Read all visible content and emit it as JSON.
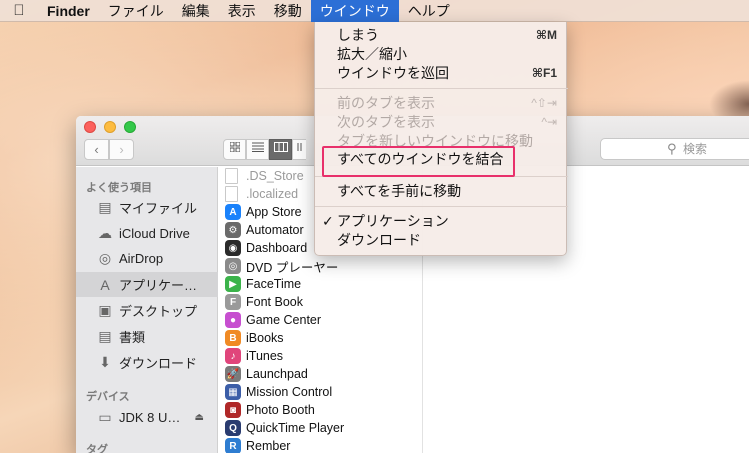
{
  "menubar": {
    "apple_icon": "apple-icon",
    "items": [
      "Finder",
      "ファイル",
      "編集",
      "表示",
      "移動",
      "ウインドウ",
      "ヘルプ"
    ]
  },
  "window_menu": {
    "items": [
      {
        "label": "しまう",
        "shortcut": "⌘M",
        "disabled": false
      },
      {
        "label": "拡大／縮小",
        "shortcut": "",
        "disabled": false
      },
      {
        "label": "ウインドウを巡回",
        "shortcut": "⌘F1",
        "disabled": false
      },
      {
        "label": "前のタブを表示",
        "shortcut": "^⇧⇥",
        "disabled": true
      },
      {
        "label": "次のタブを表示",
        "shortcut": "^⇥",
        "disabled": true
      },
      {
        "label": "タブを新しいウインドウに移動",
        "shortcut": "",
        "disabled": true
      },
      {
        "label": "すべてのウインドウを結合",
        "shortcut": "",
        "disabled": false
      },
      {
        "label": "すべてを手前に移動",
        "shortcut": "",
        "disabled": false
      },
      {
        "label": "アプリケーション",
        "shortcut": "",
        "disabled": false,
        "checked": true
      },
      {
        "label": "ダウンロード",
        "shortcut": "",
        "disabled": false
      }
    ],
    "check_mark": "✓"
  },
  "toolbar": {
    "back": "‹",
    "forward": "›",
    "search_placeholder": "検索"
  },
  "sidebar": {
    "favorites_header": "よく使う項目",
    "favorites": [
      {
        "label": "マイファイル",
        "icon": "all-files-icon"
      },
      {
        "label": "iCloud Drive",
        "icon": "cloud-icon"
      },
      {
        "label": "AirDrop",
        "icon": "airdrop-icon"
      },
      {
        "label": "アプリケー…",
        "icon": "applications-icon",
        "selected": true
      },
      {
        "label": "デスクトップ",
        "icon": "desktop-icon"
      },
      {
        "label": "書類",
        "icon": "documents-icon"
      },
      {
        "label": "ダウンロード",
        "icon": "downloads-icon"
      }
    ],
    "devices_header": "デバイス",
    "devices": [
      {
        "label": "JDK 8 U…",
        "icon": "disk-icon"
      }
    ],
    "tags_header": "タグ"
  },
  "files": [
    {
      "name": ".DS_Store",
      "dim": true,
      "icon": "document-icon",
      "color": ""
    },
    {
      "name": ".localized",
      "dim": true,
      "icon": "document-icon",
      "color": ""
    },
    {
      "name": "App Store",
      "dim": false,
      "icon": "app-store-icon",
      "color": "#1a82fb"
    },
    {
      "name": "Automator",
      "dim": false,
      "icon": "automator-icon",
      "color": "#6b6b6b"
    },
    {
      "name": "Dashboard",
      "dim": false,
      "icon": "dashboard-icon",
      "color": "#2b2b2b"
    },
    {
      "name": "DVD プレーヤー",
      "dim": false,
      "icon": "dvd-player-icon",
      "color": "#8a8a8a"
    },
    {
      "name": "FaceTime",
      "dim": false,
      "icon": "facetime-icon",
      "color": "#3bb34a"
    },
    {
      "name": "Font Book",
      "dim": false,
      "icon": "font-book-icon",
      "color": "#9a9a9a"
    },
    {
      "name": "Game Center",
      "dim": false,
      "icon": "game-center-icon",
      "color": "#c74fd0"
    },
    {
      "name": "iBooks",
      "dim": false,
      "icon": "ibooks-icon",
      "color": "#f08a24"
    },
    {
      "name": "iTunes",
      "dim": false,
      "icon": "itunes-icon",
      "color": "#e0457b"
    },
    {
      "name": "Launchpad",
      "dim": false,
      "icon": "launchpad-icon",
      "color": "#7a7a7a"
    },
    {
      "name": "Mission Control",
      "dim": false,
      "icon": "mission-control-icon",
      "color": "#3c5ea8"
    },
    {
      "name": "Photo Booth",
      "dim": false,
      "icon": "photo-booth-icon",
      "color": "#b02828"
    },
    {
      "name": "QuickTime Player",
      "dim": false,
      "icon": "quicktime-icon",
      "color": "#2a3c70"
    },
    {
      "name": "Rember",
      "dim": false,
      "icon": "rember-icon",
      "color": "#2e7dd1"
    }
  ],
  "colors": {
    "menu_highlight": "#2c6fd6",
    "annotation_box": "#e8306b"
  }
}
